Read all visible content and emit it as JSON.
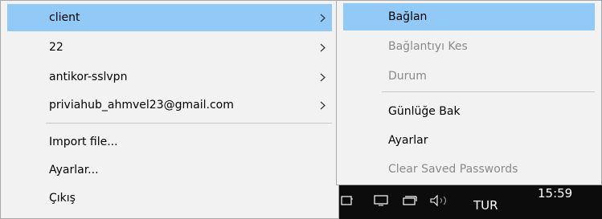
{
  "main_menu": {
    "items": [
      {
        "label": "client"
      },
      {
        "label": "22"
      },
      {
        "label": "antikor-sslvpn"
      },
      {
        "label": "priviahub_ahmvel23@gmail.com"
      },
      {
        "label": "Import file..."
      },
      {
        "label": "Ayarlar..."
      },
      {
        "label": "Çıkış"
      }
    ]
  },
  "sub_menu": {
    "items": [
      {
        "label": "Bağlan",
        "state": "highlighted"
      },
      {
        "label": "Bağlantıyı Kes",
        "state": "disabled"
      },
      {
        "label": "Durum",
        "state": "disabled"
      },
      {
        "label": "Günlüğe Bak",
        "state": "enabled"
      },
      {
        "label": "Ayarlar",
        "state": "enabled"
      },
      {
        "label": "Clear Saved Passwords",
        "state": "disabled"
      }
    ]
  },
  "taskbar": {
    "language": "TUR",
    "time": "15:59"
  },
  "colors": {
    "highlight": "#91c9f7",
    "menu_bg": "#f2f2f2",
    "disabled_text": "#8a8a8a",
    "taskbar_bg": "#0c0c0c"
  }
}
